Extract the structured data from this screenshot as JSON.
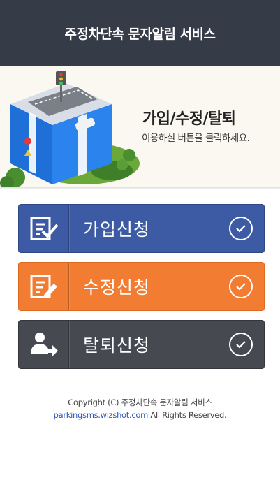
{
  "header": {
    "title": "주정차단속 문자알림 서비스"
  },
  "banner": {
    "title": "가입/수정/탈퇴",
    "subtitle": "이용하실 버튼을 클릭하세요."
  },
  "buttons": {
    "join": {
      "label": "가입신청",
      "icon": "document-check-icon",
      "color": "#3d5aa4"
    },
    "edit": {
      "label": "수정신청",
      "icon": "document-edit-icon",
      "color": "#f27c32"
    },
    "quit": {
      "label": "탈퇴신청",
      "icon": "user-exit-icon",
      "color": "#464950"
    }
  },
  "footer": {
    "copyright": "Copyright (C) 주정차단속 문자알림 서비스",
    "link": "parkingsms.wizshot.com",
    "rights": " All Rights Reserved."
  }
}
